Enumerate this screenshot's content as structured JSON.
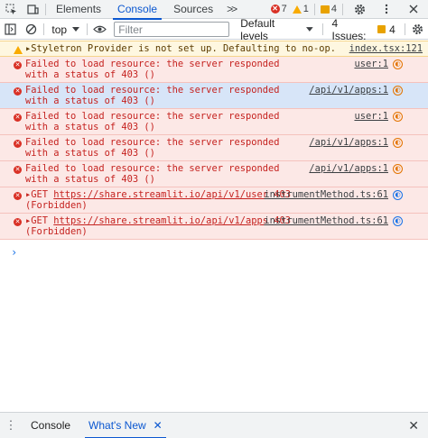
{
  "tabs": {
    "items": [
      "Elements",
      "Console",
      "Sources"
    ],
    "more": ">>",
    "error_count": "7",
    "warning_count": "1",
    "issues_count": "4"
  },
  "toolbar": {
    "context": "top",
    "filter_placeholder": "Filter",
    "levels": "Default levels",
    "issues_label": "4 Issues:",
    "issues_count": "4"
  },
  "messages": [
    {
      "kind": "warn",
      "text": "▸Styletron Provider is not set up. Defaulting to no-op.",
      "source": "index.tsx:121"
    },
    {
      "kind": "err",
      "text": "Failed to load resource: the server responded with a status of 403 ()",
      "source": "user:1"
    },
    {
      "kind": "err",
      "text": "Failed to load resource: the server responded with a status of 403 ()",
      "source": "/api/v1/apps:1"
    },
    {
      "kind": "err",
      "text": "Failed to load resource: the server responded with a status of 403 ()",
      "source": "user:1"
    },
    {
      "kind": "err",
      "text": "Failed to load resource: the server responded with a status of 403 ()",
      "source": "/api/v1/apps:1"
    },
    {
      "kind": "err",
      "text": "Failed to load resource: the server responded with a status of 403 ()",
      "source": "/api/v1/apps:1"
    },
    {
      "kind": "get",
      "prefix": "▸GET ",
      "url": "https://share.streamlit.io/api/v1/user",
      "status": " 403",
      "status2": "(Forbidden)",
      "source": "instrumentMethod.ts:61"
    },
    {
      "kind": "get",
      "prefix": "▸GET ",
      "url": "https://share.streamlit.io/api/v1/apps",
      "status": " 403",
      "status2": "(Forbidden)",
      "source": "instrumentMethod.ts:61"
    }
  ],
  "prompt": "›",
  "drawer": {
    "tabs": [
      "Console",
      "What's New"
    ],
    "close": "✕"
  }
}
